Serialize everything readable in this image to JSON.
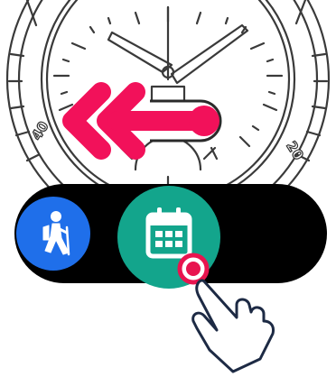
{
  "watch_face": {
    "bezel_numbers": [
      "40",
      "20"
    ]
  },
  "gesture": {
    "swipe_direction": "left",
    "arrow_color": "#f2115a",
    "touch_point_color": "#e8144f",
    "icon": "hand-pointer-icon"
  },
  "app_bar": {
    "apps": [
      {
        "name": "hiking",
        "icon": "hiking-person-icon",
        "color": "#1f6fea"
      },
      {
        "name": "calendar",
        "icon": "calendar-icon",
        "color": "#13a58c"
      }
    ]
  }
}
